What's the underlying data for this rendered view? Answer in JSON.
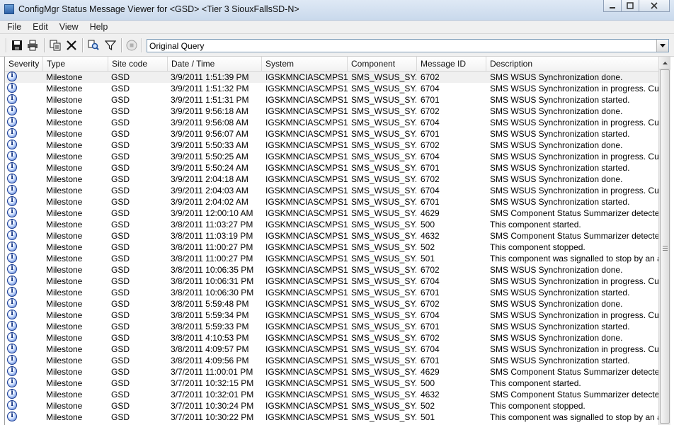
{
  "window": {
    "title": "ConfigMgr Status Message Viewer for <GSD> <Tier 3 SiouxFallsSD-N>",
    "minimize_icon": "minimize-icon",
    "maximize_icon": "maximize-icon",
    "close_icon": "close-icon"
  },
  "menu": [
    "File",
    "Edit",
    "View",
    "Help"
  ],
  "toolbar": {
    "buttons": [
      "save-icon",
      "print-icon",
      "copy-icon",
      "delete-icon",
      "find-icon",
      "filter-icon",
      "stop-icon"
    ],
    "query": "Original Query"
  },
  "columns": [
    "Severity",
    "Type",
    "Site code",
    "Date / Time",
    "System",
    "Component",
    "Message ID",
    "Description"
  ],
  "rows": [
    {
      "type": "Milestone",
      "site": "GSD",
      "datetime": "3/9/2011 1:51:39 PM",
      "system": "IGSKMNCIASCMPS1",
      "component": "SMS_WSUS_SY...",
      "message_id": "6702",
      "description": "SMS WSUS Synchronization done."
    },
    {
      "type": "Milestone",
      "site": "GSD",
      "datetime": "3/9/2011 1:51:32 PM",
      "system": "IGSKMNCIASCMPS1",
      "component": "SMS_WSUS_SY...",
      "message_id": "6704",
      "description": "SMS WSUS Synchronization in progress. Curr"
    },
    {
      "type": "Milestone",
      "site": "GSD",
      "datetime": "3/9/2011 1:51:31 PM",
      "system": "IGSKMNCIASCMPS1",
      "component": "SMS_WSUS_SY...",
      "message_id": "6701",
      "description": "SMS WSUS Synchronization started."
    },
    {
      "type": "Milestone",
      "site": "GSD",
      "datetime": "3/9/2011 9:56:18 AM",
      "system": "IGSKMNCIASCMPS1",
      "component": "SMS_WSUS_SY...",
      "message_id": "6702",
      "description": "SMS WSUS Synchronization done."
    },
    {
      "type": "Milestone",
      "site": "GSD",
      "datetime": "3/9/2011 9:56:08 AM",
      "system": "IGSKMNCIASCMPS1",
      "component": "SMS_WSUS_SY...",
      "message_id": "6704",
      "description": "SMS WSUS Synchronization in progress. Curr"
    },
    {
      "type": "Milestone",
      "site": "GSD",
      "datetime": "3/9/2011 9:56:07 AM",
      "system": "IGSKMNCIASCMPS1",
      "component": "SMS_WSUS_SY...",
      "message_id": "6701",
      "description": "SMS WSUS Synchronization started."
    },
    {
      "type": "Milestone",
      "site": "GSD",
      "datetime": "3/9/2011 5:50:33 AM",
      "system": "IGSKMNCIASCMPS1",
      "component": "SMS_WSUS_SY...",
      "message_id": "6702",
      "description": "SMS WSUS Synchronization done."
    },
    {
      "type": "Milestone",
      "site": "GSD",
      "datetime": "3/9/2011 5:50:25 AM",
      "system": "IGSKMNCIASCMPS1",
      "component": "SMS_WSUS_SY...",
      "message_id": "6704",
      "description": "SMS WSUS Synchronization in progress. Curr"
    },
    {
      "type": "Milestone",
      "site": "GSD",
      "datetime": "3/9/2011 5:50:24 AM",
      "system": "IGSKMNCIASCMPS1",
      "component": "SMS_WSUS_SY...",
      "message_id": "6701",
      "description": "SMS WSUS Synchronization started."
    },
    {
      "type": "Milestone",
      "site": "GSD",
      "datetime": "3/9/2011 2:04:18 AM",
      "system": "IGSKMNCIASCMPS1",
      "component": "SMS_WSUS_SY...",
      "message_id": "6702",
      "description": "SMS WSUS Synchronization done."
    },
    {
      "type": "Milestone",
      "site": "GSD",
      "datetime": "3/9/2011 2:04:03 AM",
      "system": "IGSKMNCIASCMPS1",
      "component": "SMS_WSUS_SY...",
      "message_id": "6704",
      "description": "SMS WSUS Synchronization in progress. Curr"
    },
    {
      "type": "Milestone",
      "site": "GSD",
      "datetime": "3/9/2011 2:04:02 AM",
      "system": "IGSKMNCIASCMPS1",
      "component": "SMS_WSUS_SY...",
      "message_id": "6701",
      "description": "SMS WSUS Synchronization started."
    },
    {
      "type": "Milestone",
      "site": "GSD",
      "datetime": "3/9/2011 12:00:10 AM",
      "system": "IGSKMNCIASCMPS1",
      "component": "SMS_WSUS_SY...",
      "message_id": "4629",
      "description": "SMS Component Status Summarizer detected"
    },
    {
      "type": "Milestone",
      "site": "GSD",
      "datetime": "3/8/2011 11:03:27 PM",
      "system": "IGSKMNCIASCMPS1",
      "component": "SMS_WSUS_SY...",
      "message_id": "500",
      "description": "This component started."
    },
    {
      "type": "Milestone",
      "site": "GSD",
      "datetime": "3/8/2011 11:03:19 PM",
      "system": "IGSKMNCIASCMPS1",
      "component": "SMS_WSUS_SY...",
      "message_id": "4632",
      "description": "SMS Component Status Summarizer detected"
    },
    {
      "type": "Milestone",
      "site": "GSD",
      "datetime": "3/8/2011 11:00:27 PM",
      "system": "IGSKMNCIASCMPS1",
      "component": "SMS_WSUS_SY...",
      "message_id": "502",
      "description": "This component stopped."
    },
    {
      "type": "Milestone",
      "site": "GSD",
      "datetime": "3/8/2011 11:00:27 PM",
      "system": "IGSKMNCIASCMPS1",
      "component": "SMS_WSUS_SY...",
      "message_id": "501",
      "description": "This component was signalled to stop by an a"
    },
    {
      "type": "Milestone",
      "site": "GSD",
      "datetime": "3/8/2011 10:06:35 PM",
      "system": "IGSKMNCIASCMPS1",
      "component": "SMS_WSUS_SY...",
      "message_id": "6702",
      "description": "SMS WSUS Synchronization done."
    },
    {
      "type": "Milestone",
      "site": "GSD",
      "datetime": "3/8/2011 10:06:31 PM",
      "system": "IGSKMNCIASCMPS1",
      "component": "SMS_WSUS_SY...",
      "message_id": "6704",
      "description": "SMS WSUS Synchronization in progress. Curr"
    },
    {
      "type": "Milestone",
      "site": "GSD",
      "datetime": "3/8/2011 10:06:30 PM",
      "system": "IGSKMNCIASCMPS1",
      "component": "SMS_WSUS_SY...",
      "message_id": "6701",
      "description": "SMS WSUS Synchronization started."
    },
    {
      "type": "Milestone",
      "site": "GSD",
      "datetime": "3/8/2011 5:59:48 PM",
      "system": "IGSKMNCIASCMPS1",
      "component": "SMS_WSUS_SY...",
      "message_id": "6702",
      "description": "SMS WSUS Synchronization done."
    },
    {
      "type": "Milestone",
      "site": "GSD",
      "datetime": "3/8/2011 5:59:34 PM",
      "system": "IGSKMNCIASCMPS1",
      "component": "SMS_WSUS_SY...",
      "message_id": "6704",
      "description": "SMS WSUS Synchronization in progress. Curr"
    },
    {
      "type": "Milestone",
      "site": "GSD",
      "datetime": "3/8/2011 5:59:33 PM",
      "system": "IGSKMNCIASCMPS1",
      "component": "SMS_WSUS_SY...",
      "message_id": "6701",
      "description": "SMS WSUS Synchronization started."
    },
    {
      "type": "Milestone",
      "site": "GSD",
      "datetime": "3/8/2011 4:10:53 PM",
      "system": "IGSKMNCIASCMPS1",
      "component": "SMS_WSUS_SY...",
      "message_id": "6702",
      "description": "SMS WSUS Synchronization done."
    },
    {
      "type": "Milestone",
      "site": "GSD",
      "datetime": "3/8/2011 4:09:57 PM",
      "system": "IGSKMNCIASCMPS1",
      "component": "SMS_WSUS_SY...",
      "message_id": "6704",
      "description": "SMS WSUS Synchronization in progress. Curr"
    },
    {
      "type": "Milestone",
      "site": "GSD",
      "datetime": "3/8/2011 4:09:56 PM",
      "system": "IGSKMNCIASCMPS1",
      "component": "SMS_WSUS_SY...",
      "message_id": "6701",
      "description": "SMS WSUS Synchronization started."
    },
    {
      "type": "Milestone",
      "site": "GSD",
      "datetime": "3/7/2011 11:00:01 PM",
      "system": "IGSKMNCIASCMPS1",
      "component": "SMS_WSUS_SY...",
      "message_id": "4629",
      "description": "SMS Component Status Summarizer detected"
    },
    {
      "type": "Milestone",
      "site": "GSD",
      "datetime": "3/7/2011 10:32:15 PM",
      "system": "IGSKMNCIASCMPS1",
      "component": "SMS_WSUS_SY...",
      "message_id": "500",
      "description": "This component started."
    },
    {
      "type": "Milestone",
      "site": "GSD",
      "datetime": "3/7/2011 10:32:01 PM",
      "system": "IGSKMNCIASCMPS1",
      "component": "SMS_WSUS_SY...",
      "message_id": "4632",
      "description": "SMS Component Status Summarizer detected"
    },
    {
      "type": "Milestone",
      "site": "GSD",
      "datetime": "3/7/2011 10:30:24 PM",
      "system": "IGSKMNCIASCMPS1",
      "component": "SMS_WSUS_SY...",
      "message_id": "502",
      "description": "This component stopped."
    },
    {
      "type": "Milestone",
      "site": "GSD",
      "datetime": "3/7/2011 10:30:22 PM",
      "system": "IGSKMNCIASCMPS1",
      "component": "SMS_WSUS_SY...",
      "message_id": "501",
      "description": "This component was signalled to stop by an a"
    }
  ],
  "severity_icon": "information-icon",
  "colors": {
    "titlebar": "#c9d9ec",
    "selected_row": "#f0f0f0",
    "info_icon": "#3b68c9"
  }
}
